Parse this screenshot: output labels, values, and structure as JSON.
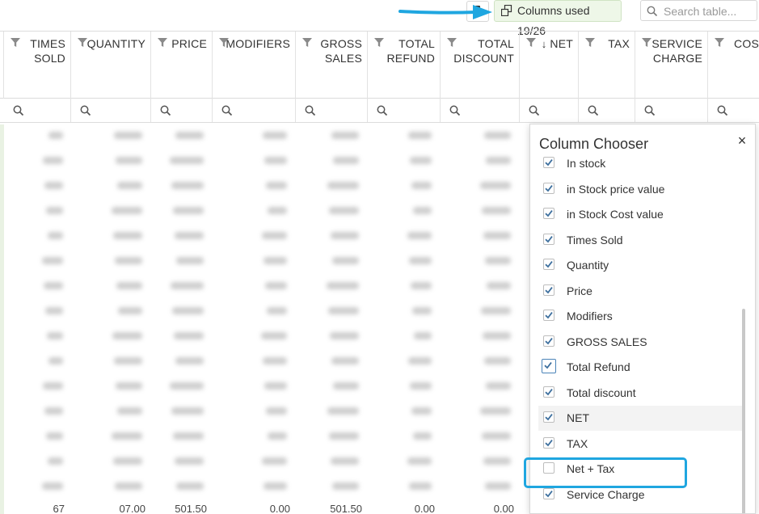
{
  "toolbar": {
    "columns_used_label": "Columns used 19/26",
    "search_placeholder": "Search table..."
  },
  "grid": {
    "columns": [
      {
        "key": "times-sold",
        "line1": "TIMES",
        "line2": "SOLD"
      },
      {
        "key": "quantity",
        "line1": "QUANTITY",
        "line2": ""
      },
      {
        "key": "price",
        "line1": "PRICE",
        "line2": ""
      },
      {
        "key": "modifiers",
        "line1": "MODIFIERS",
        "line2": ""
      },
      {
        "key": "gross-sales",
        "line1": "GROSS",
        "line2": "SALES"
      },
      {
        "key": "total-refund",
        "line1": "TOTAL",
        "line2": "REFUND"
      },
      {
        "key": "total-discount",
        "line1": "TOTAL",
        "line2": "DISCOUNT"
      },
      {
        "key": "net",
        "line1": "NET",
        "line2": "",
        "sorted": "desc"
      },
      {
        "key": "tax",
        "line1": "TAX",
        "line2": ""
      },
      {
        "key": "service-charge",
        "line1": "SERVICE",
        "line2": "CHARGE"
      },
      {
        "key": "cost",
        "line1": "COS",
        "line2": ""
      }
    ],
    "bottom_row": [
      "67",
      "07.00",
      "501.50",
      "0.00",
      "501.50",
      "0.00",
      "0.00"
    ]
  },
  "column_chooser": {
    "title": "Column Chooser",
    "close_label": "×",
    "items": [
      {
        "label": "In stock",
        "checked": true
      },
      {
        "label": "in Stock price value",
        "checked": true
      },
      {
        "label": "in Stock Cost value",
        "checked": true
      },
      {
        "label": "Times Sold",
        "checked": true
      },
      {
        "label": "Quantity",
        "checked": true
      },
      {
        "label": "Price",
        "checked": true
      },
      {
        "label": "Modifiers",
        "checked": true
      },
      {
        "label": "GROSS SALES",
        "checked": true
      },
      {
        "label": "Total Refund",
        "checked": true,
        "focused": true
      },
      {
        "label": "Total discount",
        "checked": true
      },
      {
        "label": "NET",
        "checked": true,
        "highlighted": true
      },
      {
        "label": "TAX",
        "checked": true
      },
      {
        "label": "Net + Tax",
        "checked": false
      },
      {
        "label": "Service Charge",
        "checked": true
      }
    ]
  },
  "colors": {
    "accent": "#1fa6e0",
    "checkbox": "#3d6f9e",
    "columns_used_bg": "#eef7e8"
  }
}
